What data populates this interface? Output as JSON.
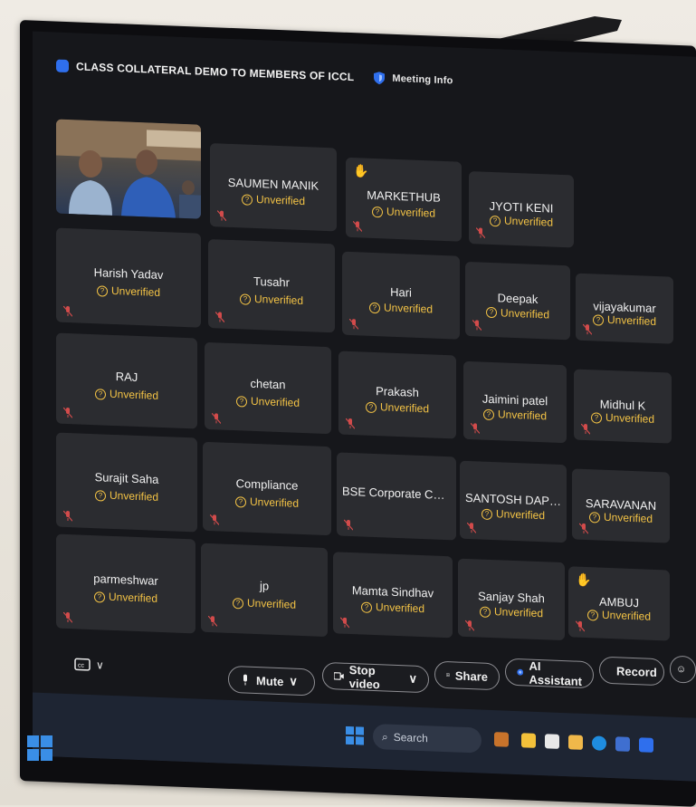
{
  "meeting": {
    "title": "CLASS COLLATERAL DEMO TO MEMBERS OF ICCL",
    "info_label": "Meeting Info"
  },
  "status_label": "Unverified",
  "participants": [
    {
      "name": "SAUMEN MANIK",
      "status": "Unverified",
      "hand": false
    },
    {
      "name": "MARKETHUB",
      "status": "Unverified",
      "hand": true
    },
    {
      "name": "JYOTI KENI",
      "status": "Unverified",
      "hand": false
    },
    {
      "name": "Harish Yadav",
      "status": "Unverified",
      "hand": false
    },
    {
      "name": "Tusahr",
      "status": "Unverified",
      "hand": false
    },
    {
      "name": "Hari",
      "status": "Unverified",
      "hand": false
    },
    {
      "name": "Deepak",
      "status": "Unverified",
      "hand": false
    },
    {
      "name": "vijayakumar",
      "status": "Unverified",
      "hand": false
    },
    {
      "name": "RAJ",
      "status": "Unverified",
      "hand": false
    },
    {
      "name": "chetan",
      "status": "Unverified",
      "hand": false
    },
    {
      "name": "Prakash",
      "status": "Unverified",
      "hand": false
    },
    {
      "name": "Jaimini patel",
      "status": "Unverified",
      "hand": false
    },
    {
      "name": "Midhul K",
      "status": "Unverified",
      "hand": false
    },
    {
      "name": "Surajit Saha",
      "status": "Unverified",
      "hand": false
    },
    {
      "name": "Compliance",
      "status": "Unverified",
      "hand": false
    },
    {
      "name": "BSE Corporate Comm...",
      "status": "",
      "hand": false
    },
    {
      "name": "SANTOSH DAPHALE",
      "status": "Unverified",
      "hand": false
    },
    {
      "name": "SARAVANAN",
      "status": "Unverified",
      "hand": false
    },
    {
      "name": "parmeshwar",
      "status": "Unverified",
      "hand": false
    },
    {
      "name": "jp",
      "status": "Unverified",
      "hand": false
    },
    {
      "name": "Mamta Sindhav",
      "status": "Unverified",
      "hand": false
    },
    {
      "name": "Sanjay Shah",
      "status": "Unverified",
      "hand": false
    },
    {
      "name": "AMBUJ",
      "status": "Unverified",
      "hand": true
    }
  ],
  "toolbar": {
    "mute": "Mute",
    "stop_video": "Stop video",
    "share": "Share",
    "ai_assistant": "AI Assistant",
    "record": "Record"
  },
  "taskbar": {
    "search_placeholder": "Search"
  },
  "colors": {
    "tile_bg": "#2b2c30",
    "unverified": "#f2c245",
    "hand": "#f6c444",
    "zoom_blue": "#2f6fed"
  }
}
